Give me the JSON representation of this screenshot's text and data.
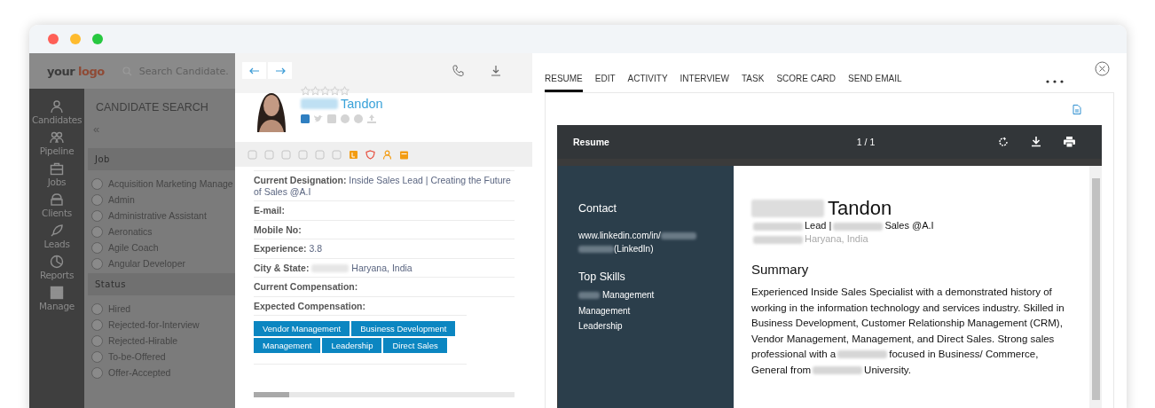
{
  "window": {
    "controls": [
      {
        "color": "#fe5f57"
      },
      {
        "color": "#febb2e"
      },
      {
        "color": "#27c840"
      }
    ]
  },
  "topbar": {
    "logo_parts": [
      "your",
      "logo"
    ],
    "search": {
      "placeholder": "Search Candidate."
    }
  },
  "nav": [
    {
      "kind": "person",
      "label": "Candidates"
    },
    {
      "kind": "people",
      "label": "Pipeline"
    },
    {
      "kind": "briefcase",
      "label": "Jobs"
    },
    {
      "kind": "building",
      "label": "Clients"
    },
    {
      "kind": "rocket",
      "label": "Leads"
    },
    {
      "kind": "clock",
      "label": "Reports"
    },
    {
      "kind": "server",
      "label": "Manage"
    }
  ],
  "filter": {
    "title": "CANDIDATE SEARCH",
    "collapse": "«",
    "groups": [
      {
        "title": "Job",
        "options": [
          {
            "label": "Acquisition Marketing Manage",
            "checked": false
          },
          {
            "label": "Admin",
            "checked": false
          },
          {
            "label": "Administrative Assistant",
            "checked": false
          },
          {
            "label": "Aeronatics",
            "checked": false
          },
          {
            "label": "Agile Coach",
            "checked": false
          },
          {
            "label": "Angular Developer",
            "checked": false
          }
        ]
      },
      {
        "title": "Status",
        "options": [
          {
            "label": "Hired",
            "checked": false
          },
          {
            "label": "Rejected-for-Interview",
            "checked": false
          },
          {
            "label": "Rejected-Hirable",
            "checked": false
          },
          {
            "label": "To-be-Offered",
            "checked": false
          },
          {
            "label": "Offer-Accepted",
            "checked": false
          }
        ]
      }
    ]
  },
  "profile": {
    "stars": 0,
    "name_parts": [
      {
        "kind": "redacted"
      },
      {
        "kind": "text",
        "text": "Tandon"
      }
    ],
    "socials": [
      {
        "kind": "linkedin",
        "on": true
      },
      {
        "kind": "twitter",
        "on": false
      },
      {
        "kind": "facebook",
        "on": false
      },
      {
        "kind": "globe",
        "on": false
      },
      {
        "kind": "skype",
        "on": false
      },
      {
        "kind": "upload",
        "on": false
      }
    ],
    "details": [
      {
        "label": "Current Designation:",
        "parts": [
          {
            "kind": "text",
            "text": "Inside Sales Lead | Creating the Future of Sales @A.I"
          }
        ]
      },
      {
        "label": "E-mail:"
      },
      {
        "label": "Mobile No:"
      },
      {
        "label": "Experience:",
        "parts": [
          {
            "kind": "text",
            "text": "3.8"
          }
        ]
      },
      {
        "label": "City & State:",
        "parts": [
          {
            "kind": "redacted"
          },
          {
            "kind": "text",
            "text": "Haryana, India"
          }
        ]
      },
      {
        "label": "Current Compensation:"
      },
      {
        "label": "Expected Compensation:"
      }
    ],
    "skills": [
      "Vendor Management",
      "Business Development",
      "Management",
      "Leadership",
      "Direct Sales"
    ]
  },
  "tabs": [
    {
      "label": "RESUME",
      "selected": true
    },
    {
      "label": "EDIT",
      "selected": false
    },
    {
      "label": "ACTIVITY",
      "selected": false
    },
    {
      "label": "INTERVIEW",
      "selected": false
    },
    {
      "label": "TASK",
      "selected": false
    },
    {
      "label": "SCORE CARD",
      "selected": false
    },
    {
      "label": "SEND EMAIL",
      "selected": false
    }
  ],
  "viewer": {
    "title": "Resume",
    "page": "1 / 1"
  },
  "resume": {
    "contact_title": "Contact",
    "contact_parts": [
      {
        "kind": "text",
        "text": "www.linkedin.com/in/"
      },
      {
        "kind": "redacted"
      },
      {
        "kind": "redacted"
      },
      {
        "kind": "text",
        "text": "(LinkedIn)"
      }
    ],
    "skills_title": "Top Skills",
    "skills": [
      [
        {
          "kind": "redacted"
        },
        {
          "kind": "text",
          "text": "Management"
        }
      ],
      [
        {
          "kind": "text",
          "text": "Management"
        }
      ],
      [
        {
          "kind": "text",
          "text": "Leadership"
        }
      ]
    ],
    "name_parts": [
      {
        "kind": "redacted"
      },
      {
        "kind": "text",
        "text": "Tandon"
      }
    ],
    "headline_parts": [
      {
        "kind": "redacted"
      },
      {
        "kind": "text",
        "text": "Lead |"
      },
      {
        "kind": "redacted"
      },
      {
        "kind": "text",
        "text": "Sales @A.I"
      }
    ],
    "location_parts": [
      {
        "kind": "redacted"
      },
      {
        "kind": "text",
        "text": "Haryana, India"
      }
    ],
    "summary_title": "Summary",
    "summary_parts": [
      {
        "kind": "text",
        "text": "Experienced Inside Sales Specialist with a demonstrated history of working in the information technology and services industry. Skilled in Business Development, Customer Relationship Management (CRM), Vendor Management, Management, and Direct Sales. Strong sales professional with a"
      },
      {
        "kind": "redacted"
      },
      {
        "kind": "text",
        "text": "focused in Business/ Commerce, General from"
      },
      {
        "kind": "redacted"
      },
      {
        "kind": "text",
        "text": "University."
      }
    ]
  }
}
